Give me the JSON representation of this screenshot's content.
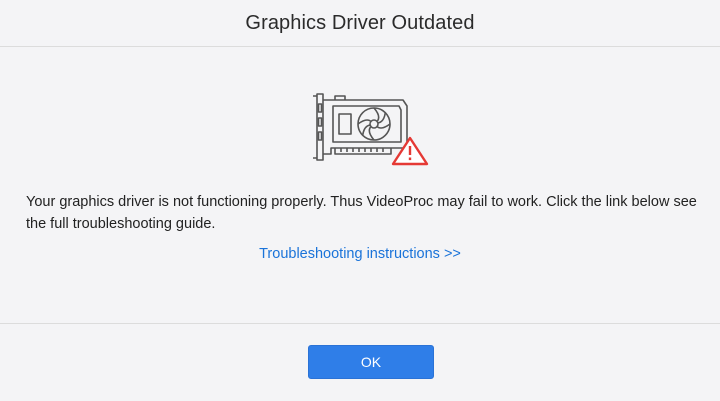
{
  "dialog": {
    "title": "Graphics Driver Outdated",
    "message": "Your graphics driver is not functioning properly. Thus VideoProc may fail to work. Click the link below see the full troubleshooting guide.",
    "link_label": "Troubleshooting instructions >>",
    "ok_label": "OK"
  },
  "icons": {
    "illustration": "graphics-card-icon",
    "warning": "warning-triangle-icon"
  },
  "colors": {
    "accent": "#2f7ee8",
    "link": "#1a73d9",
    "warning": "#e53935",
    "illustration_stroke": "#555555"
  }
}
